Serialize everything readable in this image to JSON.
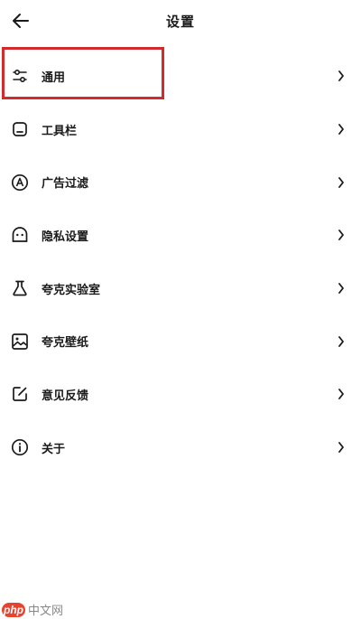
{
  "header": {
    "title": "设置",
    "back_icon": "arrow-left-icon"
  },
  "items": [
    {
      "label": "通用",
      "icon": "sliders-icon"
    },
    {
      "label": "工具栏",
      "icon": "toolbar-icon"
    },
    {
      "label": "广告过滤",
      "icon": "ad-filter-icon"
    },
    {
      "label": "隐私设置",
      "icon": "privacy-icon"
    },
    {
      "label": "夸克实验室",
      "icon": "flask-icon"
    },
    {
      "label": "夸克壁纸",
      "icon": "wallpaper-icon"
    },
    {
      "label": "意见反馈",
      "icon": "feedback-icon"
    },
    {
      "label": "关于",
      "icon": "info-icon"
    }
  ],
  "highlight_color": "#d22b2b",
  "watermark": {
    "logo": "php",
    "text": "中文网"
  }
}
